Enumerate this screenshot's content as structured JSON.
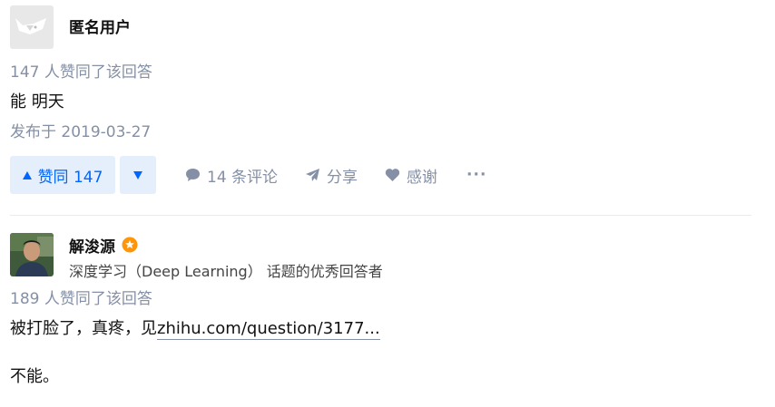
{
  "answers": [
    {
      "author": {
        "name": "匿名用户",
        "headline": ""
      },
      "voters_text": "147 人赞同了该回答",
      "content": [
        "能 明天"
      ],
      "date": "发布于 2019-03-27",
      "actions": {
        "vote_up_label": "赞同 147",
        "comment_label": "14 条评论",
        "share_label": "分享",
        "thanks_label": "感谢",
        "more_label": "···"
      }
    },
    {
      "author": {
        "name": "解浚源",
        "badge_icon": "excellent-answerer-badge-icon",
        "headline": "深度学习（Deep Learning） 话题的优秀回答者"
      },
      "voters_text": "189 人赞同了该回答",
      "content_prefix": "被打脸了，真疼，见",
      "content_link": "zhihu.com/question/3177...",
      "content_after": "不能。"
    }
  ],
  "colors": {
    "accent": "#0066ff",
    "accent_bg": "#e5effc",
    "meta": "#8590a6",
    "badge": "#ff9607"
  }
}
